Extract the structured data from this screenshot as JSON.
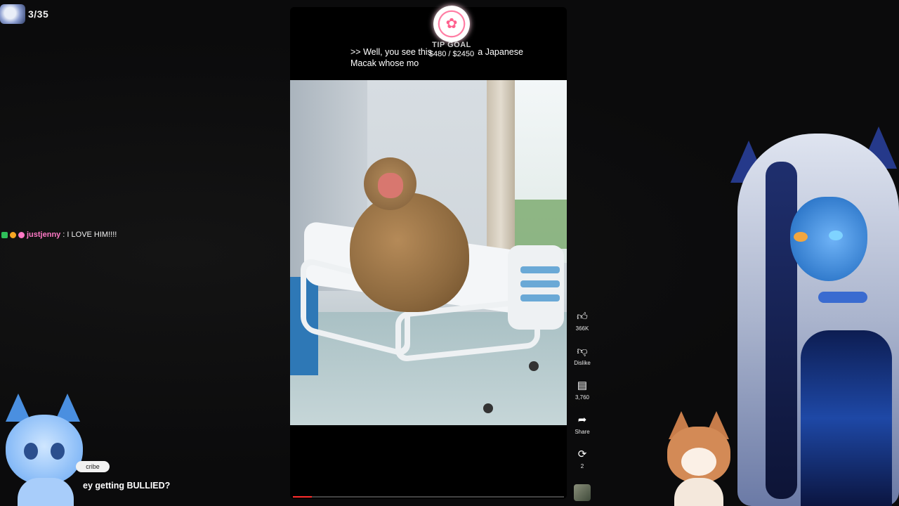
{
  "counter": {
    "value": "3/35"
  },
  "chat": {
    "username": "justjenny",
    "message": ": I LOVE HIM!!!!",
    "badge_colors": [
      "#2fbf5a",
      "#f5a623",
      "#ff79c6"
    ]
  },
  "video": {
    "caption_line1": ">> Well, you see this",
    "caption_line2": "Macak whose mo",
    "caption_tail": "a Japanese",
    "progress_fraction": 0.07,
    "progress_color": "#ff2d2d"
  },
  "tip_goal": {
    "label": "TIP GOAL",
    "amount": "$480 / $2450",
    "icon": "sakura-flower-icon",
    "accent": "#ff7fa5"
  },
  "actions": {
    "like_count": "366K",
    "dislike_label": "Dislike",
    "comments_count": "3,760",
    "share_label": "Share",
    "remix_count": "2"
  },
  "subscribe": {
    "label": "cribe"
  },
  "bottom_text": {
    "question": "ey getting BULLIED?"
  }
}
